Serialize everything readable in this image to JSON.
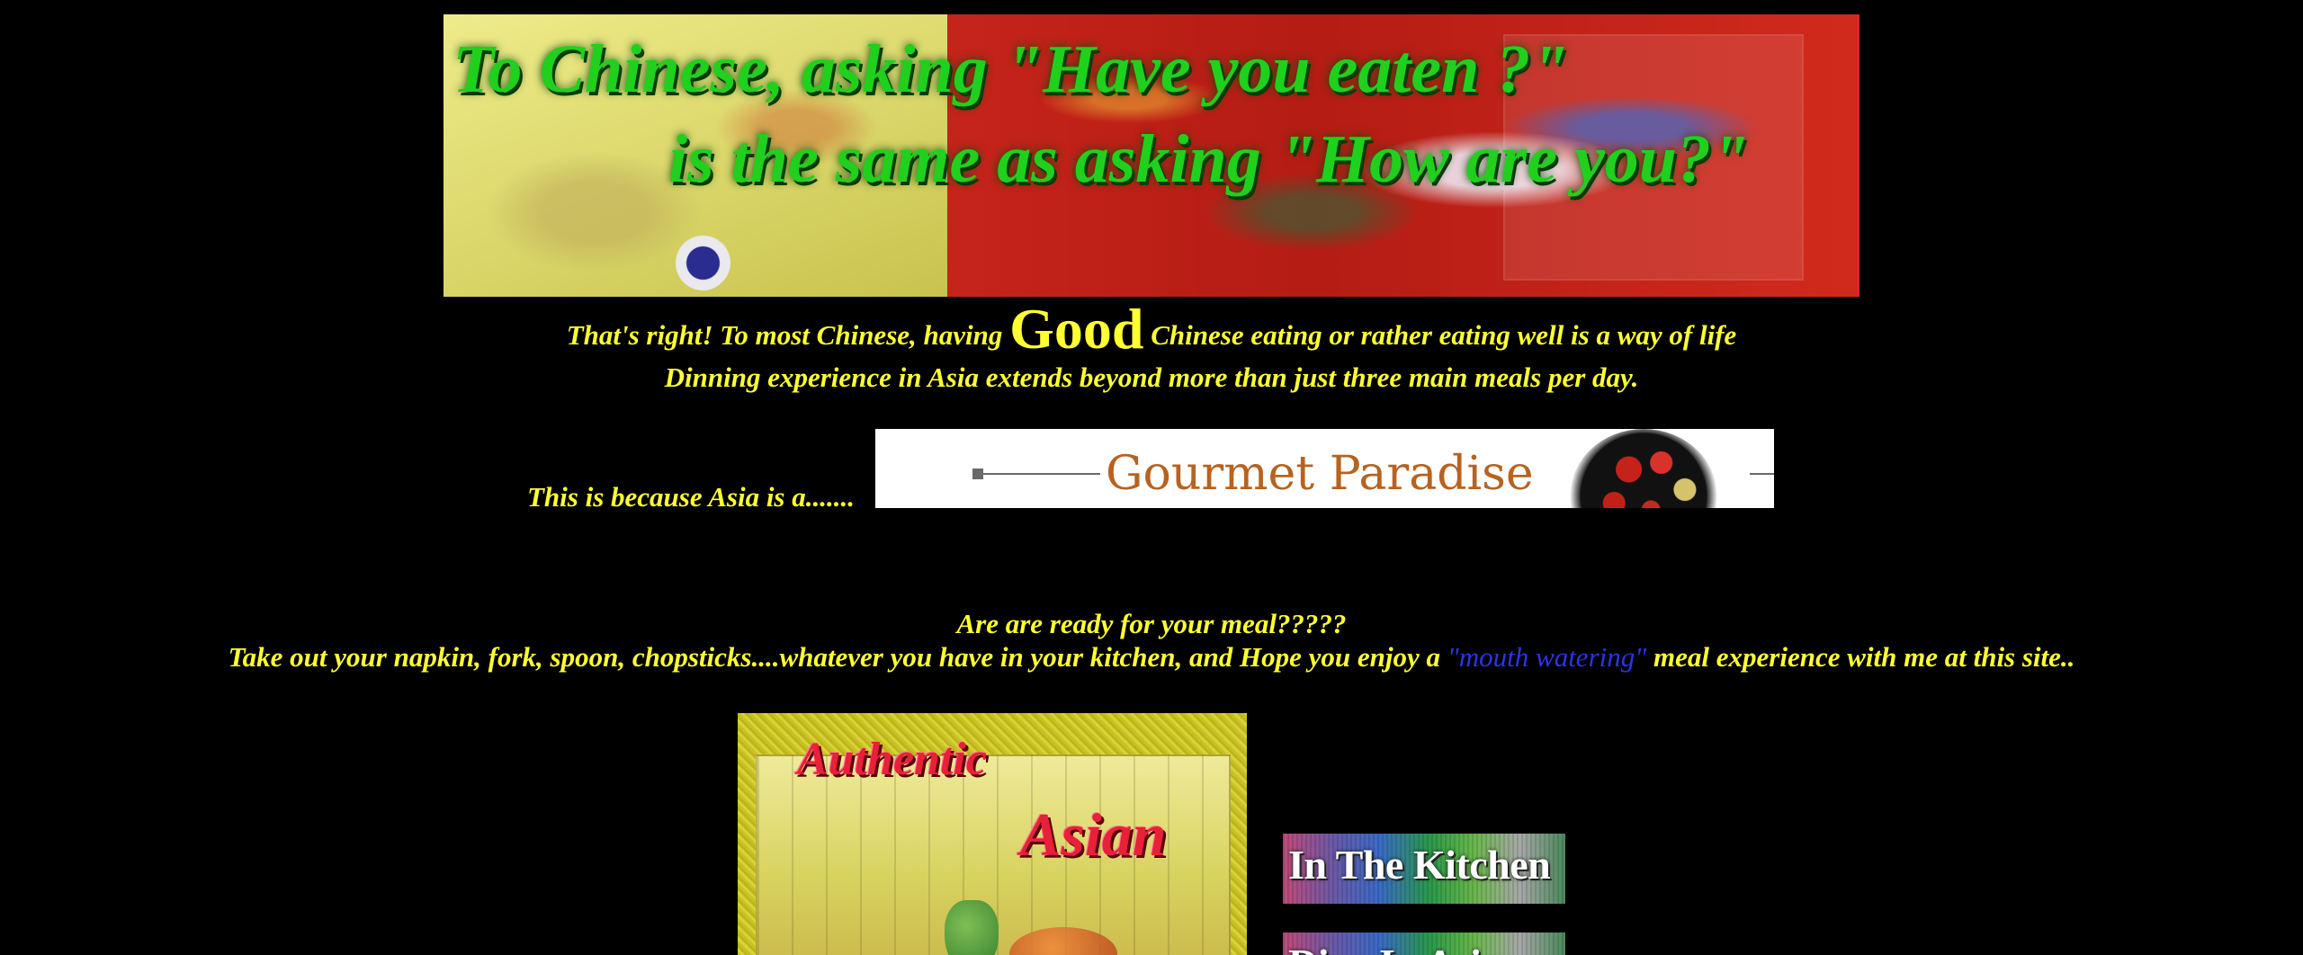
{
  "banner": {
    "line1": "To Chinese, asking \"Have you eaten ?\"",
    "line2": "is the same as asking \"How are you?\""
  },
  "intro": {
    "part1": "That's right! To most Chinese, having",
    "good": "Good",
    "part2": "Chinese eating or rather eating well is a way of life",
    "line2": "Dinning experience in Asia extends beyond more than just three main meals per day.",
    "line3": "This is because Asia is a......."
  },
  "gourmet_banner": {
    "title": "Gourmet Paradise"
  },
  "meal": {
    "question": "Are are ready for your meal?????",
    "sentence_before": "Take out your napkin, fork, spoon, chopsticks....whatever you have in your kitchen, and Hope you enjoy a",
    "highlight": "\"mouth watering\"",
    "sentence_after": "meal experience with me at this site.."
  },
  "authentic_image": {
    "word1": "Authentic",
    "word2": "Asian"
  },
  "nav": {
    "items": [
      {
        "label": "In The Kitchen"
      },
      {
        "label": "Dine In Asia"
      }
    ]
  },
  "colors": {
    "background": "#000000",
    "text": "#ffff33",
    "highlight": "#2a35e8",
    "banner_text": "#1fd11c"
  }
}
